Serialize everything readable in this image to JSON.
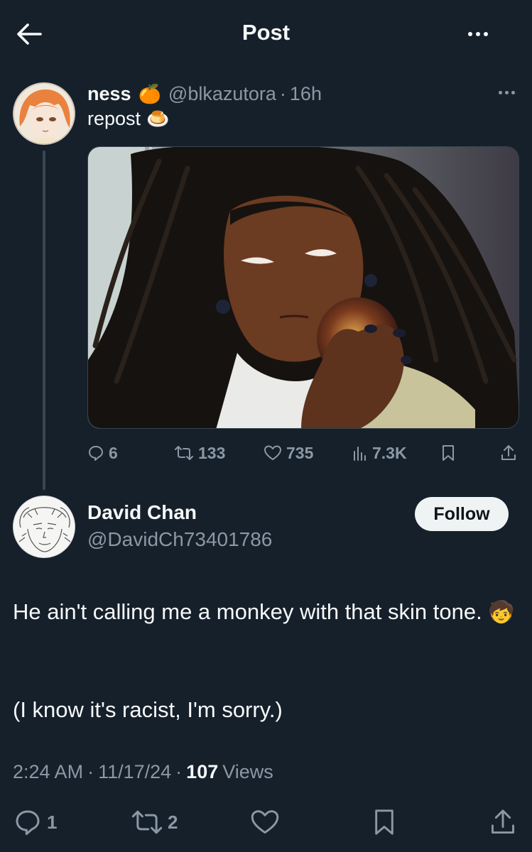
{
  "header": {
    "title": "Post"
  },
  "quoted_post": {
    "author_name": "ness",
    "author_emoji": "🍊",
    "handle": "@blkazutora",
    "separator": "·",
    "time": "16h",
    "text": "repost",
    "text_emoji": "🍮",
    "stats": {
      "replies": "6",
      "reposts": "133",
      "likes": "735",
      "views": "7.3K"
    }
  },
  "main_post": {
    "author_name": "David Chan",
    "handle": "@DavidCh73401786",
    "follow_label": "Follow",
    "text_line1": "He ain't calling me a monkey with that skin tone.",
    "text_emoji": "🧒",
    "text_line2": "(I know it's racist, I'm sorry.)",
    "time": "2:24 AM",
    "separator": "·",
    "date": "11/17/24",
    "views_count": "107",
    "views_label": "Views",
    "stats": {
      "replies": "1",
      "reposts": "2"
    }
  },
  "colors": {
    "background": "#15202b",
    "text": "#f7f9f9",
    "muted": "#8b98a5",
    "follow_bg": "#eff3f4"
  }
}
